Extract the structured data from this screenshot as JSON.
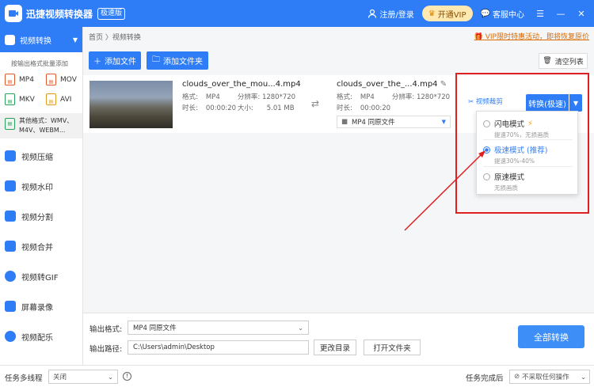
{
  "titlebar": {
    "app_title": "迅捷视频转换器",
    "edition": "极速版",
    "login": "注册/登录",
    "vip": "开通VIP",
    "support": "客服中心",
    "colors": {
      "primary": "#2f7df6",
      "vip_bg": "#ffe9b0"
    }
  },
  "sidebar": {
    "active_item": "视频转换",
    "section_label": "按输出格式批量添加",
    "formats": [
      {
        "label": "MP4",
        "color": "#e05a2b"
      },
      {
        "label": "MOV",
        "color": "#e05a2b"
      },
      {
        "label": "MKV",
        "color": "#2aa05a"
      },
      {
        "label": "AVI",
        "color": "#e09a1b"
      }
    ],
    "other_formats": "其他格式：WMV、M4V、WEBM...",
    "items": [
      {
        "label": "视频压缩",
        "icon": "compress-icon"
      },
      {
        "label": "视频水印",
        "icon": "watermark-icon"
      },
      {
        "label": "视频分割",
        "icon": "split-icon"
      },
      {
        "label": "视频合并",
        "icon": "merge-icon"
      },
      {
        "label": "视频转GIF",
        "icon": "gif-icon"
      },
      {
        "label": "屏幕录像",
        "icon": "record-icon"
      },
      {
        "label": "视频配乐",
        "icon": "music-icon"
      }
    ]
  },
  "main": {
    "breadcrumb": "首页 〉视频转换",
    "promo": "VIP限时特惠活动，即将恢复原价",
    "add_file": "添加文件",
    "add_folder": "添加文件夹",
    "clear_list": "清空列表",
    "file": {
      "source_name": "clouds_over_the_mou...4.mp4",
      "source_format_label": "格式:",
      "source_format": "MP4",
      "source_res_label": "分辨率:",
      "source_res": "1280*720",
      "source_duration_label": "时长:",
      "source_duration": "00:00:20",
      "source_size_label": "大小:",
      "source_size": "5.01 MB",
      "target_name": "clouds_over_the_...4.mp4",
      "target_format_label": "格式:",
      "target_format": "MP4",
      "target_res_label": "分辨率:",
      "target_res": "1280*720",
      "target_duration_label": "时长:",
      "target_duration": "00:00:20",
      "output_select": "MP4  同原文件",
      "trim_label": "视频裁剪",
      "convert_label": "转换(极速)"
    },
    "mode_menu": {
      "options": [
        {
          "title": "闪电模式",
          "sub": "提速70%，无损画质",
          "selected": false
        },
        {
          "title": "极速模式 (推荐)",
          "sub": "提速30%-40%",
          "selected": true
        },
        {
          "title": "原速模式",
          "sub": "无损画质",
          "selected": false
        }
      ]
    }
  },
  "bottom": {
    "output_format_label": "输出格式:",
    "output_format_value": "MP4  同原文件",
    "output_path_label": "输出路径:",
    "output_path_value": "C:\\Users\\admin\\Desktop",
    "change_dir": "更改目录",
    "open_folder": "打开文件夹",
    "convert_all": "全部转换"
  },
  "statusbar": {
    "multithread_label": "任务多线程",
    "multithread_value": "关闭",
    "on_complete_label": "任务完成后",
    "on_complete_value": "不采取任何操作"
  }
}
